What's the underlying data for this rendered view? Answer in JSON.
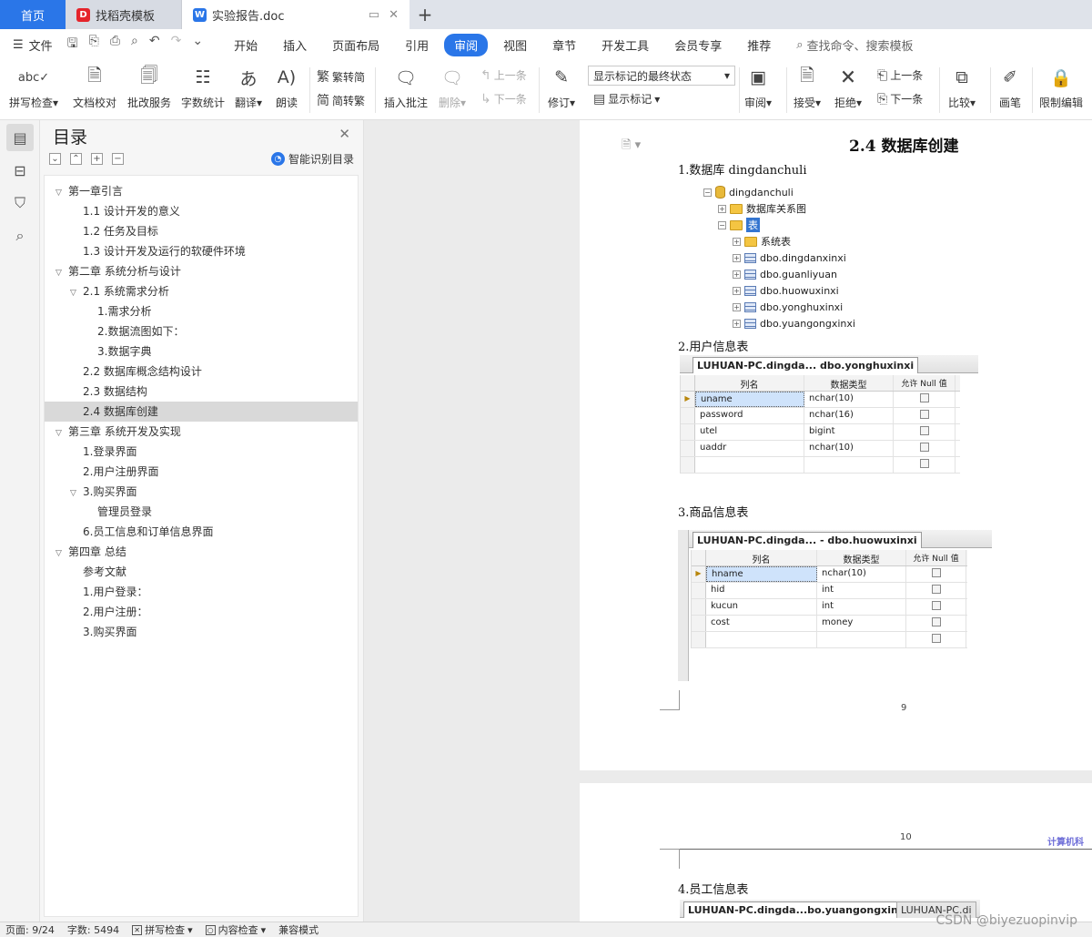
{
  "tabs": {
    "home": "首页",
    "docer": "找稻壳模板",
    "doc": "实验报告.doc",
    "new_tab": "+"
  },
  "menu": {
    "file": "文件",
    "items": [
      "开始",
      "插入",
      "页面布局",
      "引用",
      "审阅",
      "视图",
      "章节",
      "开发工具",
      "会员专享",
      "推荐"
    ],
    "active": "审阅",
    "search_placeholder": "查找命令、搜索模板"
  },
  "ribbon": {
    "spellcheck": "拼写检查",
    "doc_proof": "文档校对",
    "review_service": "批改服务",
    "word_count": "字数统计",
    "translate": "翻译",
    "read_aloud": "朗读",
    "trad": "繁转简",
    "simp": "简转繁",
    "insert_comment": "插入批注",
    "delete": "删除",
    "prev_comment": "上一条",
    "next_comment": "下一条",
    "track": "修订",
    "markup_state": "显示标记的最终状态",
    "show_markup": "显示标记",
    "review": "审阅",
    "accept": "接受",
    "reject": "拒绝",
    "prev_change": "上一条",
    "next_change": "下一条",
    "compare": "比较",
    "pen": "画笔",
    "restrict": "限制编辑"
  },
  "toc": {
    "title": "目录",
    "smart": "智能识别目录",
    "items": [
      {
        "label": "第一章引言",
        "level": 1,
        "expanded": true
      },
      {
        "label": "1.1  设计开发的意义",
        "level": 2
      },
      {
        "label": "1.2  任务及目标",
        "level": 2
      },
      {
        "label": "1.3  设计开发及运行的软硬件环境",
        "level": 2
      },
      {
        "label": "第二章  系统分析与设计",
        "level": 1,
        "expanded": true
      },
      {
        "label": "2.1  系统需求分析",
        "level": 2,
        "expanded": true
      },
      {
        "label": "1.需求分析",
        "level": 3
      },
      {
        "label": "2.数据流图如下：",
        "level": 3
      },
      {
        "label": "3.数据字典",
        "level": 3
      },
      {
        "label": "2.2  数据库概念结构设计",
        "level": 2
      },
      {
        "label": "2.3  数据结构",
        "level": 2
      },
      {
        "label": "2.4  数据库创建",
        "level": 2,
        "selected": true
      },
      {
        "label": "第三章  系统开发及实现",
        "level": 1,
        "expanded": true
      },
      {
        "label": "1.登录界面",
        "level": 2
      },
      {
        "label": "2.用户注册界面",
        "level": 2
      },
      {
        "label": "3.购买界面",
        "level": 2,
        "expanded": true
      },
      {
        "label": "管理员登录",
        "level": 3
      },
      {
        "label": "6.员工信息和订单信息界面",
        "level": 2
      },
      {
        "label": "第四章  总结",
        "level": 1,
        "expanded": true
      },
      {
        "label": "参考文献",
        "level": 2
      },
      {
        "label": "1.用户登录：",
        "level": 2
      },
      {
        "label": "2.用户注册：",
        "level": 2
      },
      {
        "label": "3.购买界面",
        "level": 2
      }
    ]
  },
  "doc": {
    "heading": "2.4  数据库创建",
    "p1": "1.数据库 dingdanchuli",
    "tree": [
      {
        "label": "dingdanchuli",
        "indent": 0,
        "icon": "db",
        "toggle": "−"
      },
      {
        "label": "数据库关系图",
        "indent": 1,
        "icon": "folder",
        "toggle": "+"
      },
      {
        "label": "表",
        "indent": 1,
        "icon": "folder",
        "toggle": "−",
        "highlight": true
      },
      {
        "label": "系统表",
        "indent": 2,
        "icon": "folder",
        "toggle": "+"
      },
      {
        "label": "dbo.dingdanxinxi",
        "indent": 2,
        "icon": "table",
        "toggle": "+"
      },
      {
        "label": "dbo.guanliyuan",
        "indent": 2,
        "icon": "table",
        "toggle": "+"
      },
      {
        "label": "dbo.huowuxinxi",
        "indent": 2,
        "icon": "table",
        "toggle": "+"
      },
      {
        "label": "dbo.yonghuxinxi",
        "indent": 2,
        "icon": "table",
        "toggle": "+"
      },
      {
        "label": "dbo.yuangongxinxi",
        "indent": 2,
        "icon": "table",
        "toggle": "+"
      }
    ],
    "p2": "2.用户信息表",
    "t1": {
      "tab": "LUHUAN-PC.dingda... dbo.yonghuxinxi",
      "headers": [
        "列名",
        "数据类型",
        "允许 Null 值"
      ],
      "rows": [
        [
          "uname",
          "nchar(10)"
        ],
        [
          "password",
          "nchar(16)"
        ],
        [
          "utel",
          "bigint"
        ],
        [
          "uaddr",
          "nchar(10)"
        ],
        [
          "",
          ""
        ]
      ]
    },
    "p3": "3.商品信息表",
    "t2": {
      "tab": "LUHUAN-PC.dingda... - dbo.huowuxinxi",
      "headers": [
        "列名",
        "数据类型",
        "允许 Null 值"
      ],
      "rows": [
        [
          "hname",
          "nchar(10)"
        ],
        [
          "hid",
          "int"
        ],
        [
          "kucun",
          "int"
        ],
        [
          "cost",
          "money"
        ],
        [
          "",
          ""
        ]
      ]
    },
    "page9": "9",
    "page10": "10",
    "header_mark": "计算机科",
    "p4": "4.员工信息表",
    "t3": {
      "tab": "LUHUAN-PC.dingda...bo.yuangongxinxi",
      "tab2": "LUHUAN-PC.di"
    }
  },
  "status": {
    "page": "页面: 9/24",
    "words": "字数: 5494",
    "spell": "拼写检查",
    "content": "内容检查",
    "compat": "兼容模式"
  },
  "watermark": "CSDN @biyezuopinvip",
  "colors": {
    "accent": "#2a76e8",
    "selection": "#d9d9d9"
  }
}
